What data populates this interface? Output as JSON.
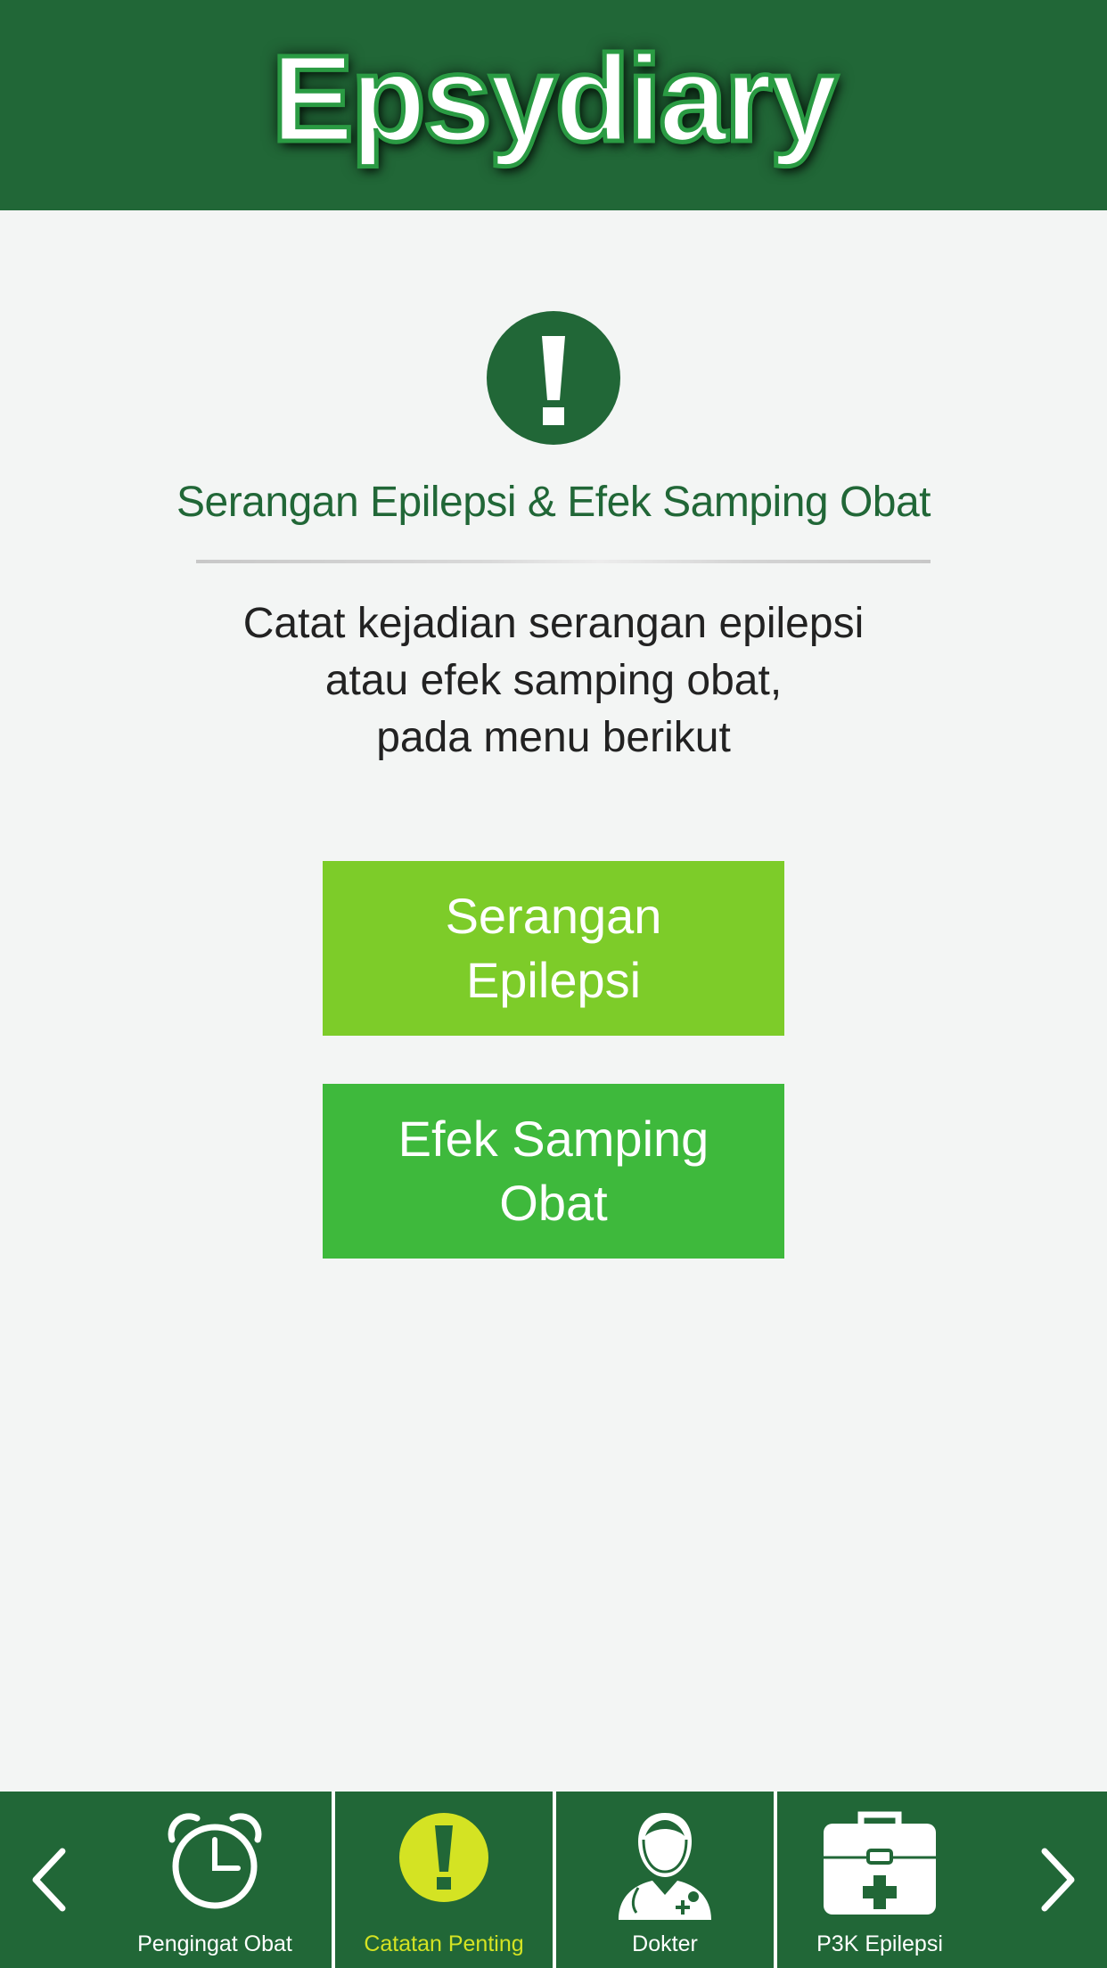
{
  "app": {
    "title": "Epsydiary"
  },
  "colors": {
    "header_bg": "#216737",
    "page_bg": "#f3f5f4",
    "title_green": "#216737",
    "button_light_green": "#7dcc29",
    "button_green": "#3eb93c",
    "active_yellow": "#d4e323"
  },
  "main": {
    "icon": "exclamation-circle-icon",
    "title": "Serangan Epilepsi & Efek Samping Obat",
    "instructions": [
      "Catat kejadian serangan epilepsi",
      "atau efek samping obat,",
      "pada menu berikut"
    ],
    "buttons": [
      {
        "lines": [
          "Serangan",
          "Epilepsi"
        ]
      },
      {
        "lines": [
          "Efek Samping",
          "Obat"
        ]
      }
    ]
  },
  "bottom_nav": {
    "prev_icon": "chevron-left-icon",
    "next_icon": "chevron-right-icon",
    "items": [
      {
        "label": "Pengingat Obat",
        "icon": "alarm-clock-icon",
        "active": false
      },
      {
        "label": "Catatan Penting",
        "icon": "exclamation-circle-icon",
        "active": true
      },
      {
        "label": "Dokter",
        "icon": "doctor-icon",
        "active": false
      },
      {
        "label": "P3K Epilepsi",
        "icon": "first-aid-kit-icon",
        "active": false
      }
    ]
  }
}
